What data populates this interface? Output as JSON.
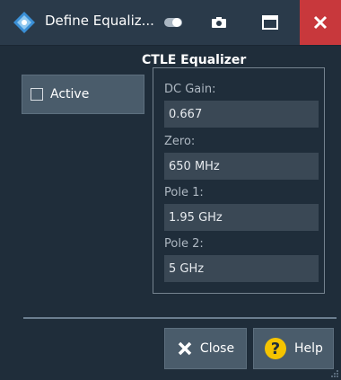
{
  "window": {
    "title": "Define Equaliz...",
    "icons": [
      "app-logo-icon",
      "toggle-icon",
      "camera-icon",
      "maximize-icon",
      "close-icon"
    ],
    "close_color": "#c8383c"
  },
  "active": {
    "label": "Active",
    "checked": false
  },
  "group": {
    "title": "CTLE Equalizer",
    "fields": [
      {
        "label": "DC Gain:",
        "value": "0.667"
      },
      {
        "label": "Zero:",
        "value": "650 MHz"
      },
      {
        "label": "Pole 1:",
        "value": "1.95 GHz"
      },
      {
        "label": "Pole 2:",
        "value": "5 GHz"
      }
    ]
  },
  "buttons": {
    "close_label": "Close",
    "help_label": "Help",
    "help_icon_color": "#f5c400"
  }
}
